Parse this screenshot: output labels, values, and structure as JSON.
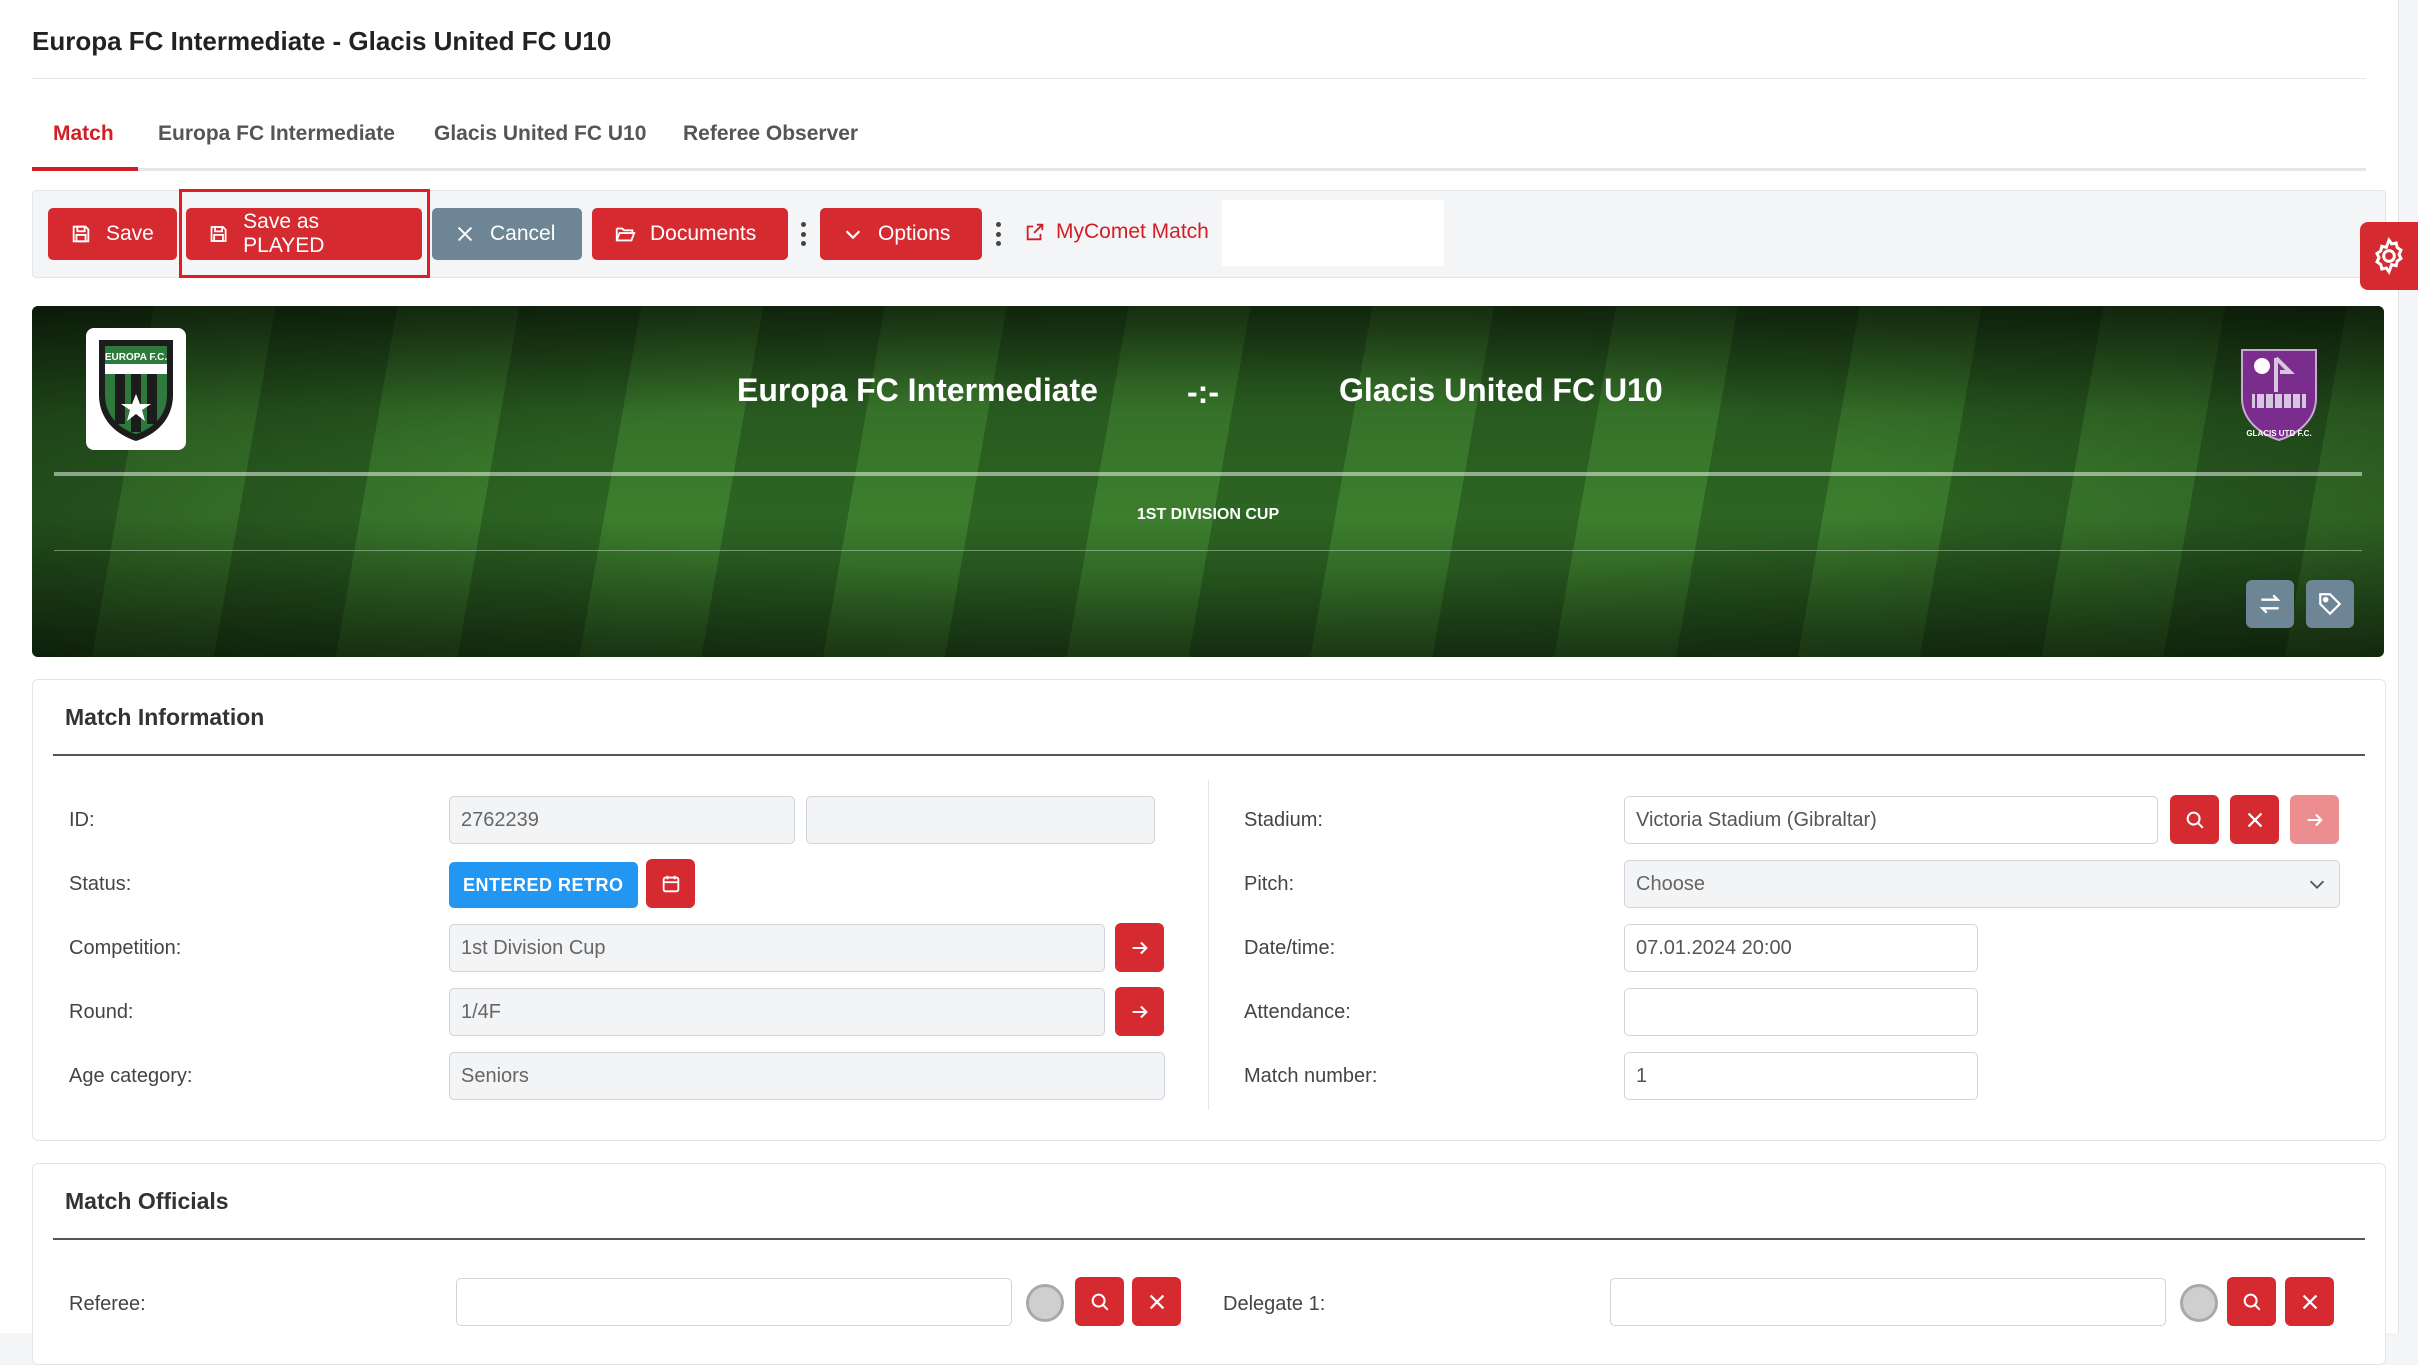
{
  "page_title": "Europa FC Intermediate - Glacis United FC U10",
  "tabs": [
    {
      "label": "Match",
      "active": true
    },
    {
      "label": "Europa FC Intermediate"
    },
    {
      "label": "Glacis United FC U10"
    },
    {
      "label": "Referee Observer"
    }
  ],
  "toolbar": {
    "save": "Save",
    "save_played": "Save as PLAYED",
    "cancel": "Cancel",
    "documents": "Documents",
    "options": "Options",
    "mycomet": "MyComet Match"
  },
  "banner": {
    "home_team": "Europa FC Intermediate",
    "score": "-:-",
    "away_team": "Glacis United FC U10",
    "competition": "1ST DIVISION CUP",
    "home_logo_text": "EUROPA F.C.",
    "away_logo_text": "GLACIS UTD F.C."
  },
  "match_info": {
    "title": "Match Information",
    "id_label": "ID:",
    "id_value": "2762239",
    "id_extra": "",
    "status_label": "Status:",
    "status_value": "ENTERED RETRO",
    "competition_label": "Competition:",
    "competition_value": "1st Division Cup",
    "round_label": "Round:",
    "round_value": "1/4F",
    "age_label": "Age category:",
    "age_value": "Seniors",
    "stadium_label": "Stadium:",
    "stadium_value": "Victoria Stadium (Gibraltar)",
    "pitch_label": "Pitch:",
    "pitch_value": "Choose",
    "datetime_label": "Date/time:",
    "datetime_value": "07.01.2024 20:00",
    "attendance_label": "Attendance:",
    "attendance_value": "",
    "match_number_label": "Match number:",
    "match_number_value": "1"
  },
  "officials": {
    "title": "Match Officials",
    "referee_label": "Referee:",
    "referee_value": "",
    "delegate_label": "Delegate 1:",
    "delegate_value": ""
  },
  "colors": {
    "accent": "#d52b30",
    "status_badge": "#2196f3",
    "secondary_button": "#6e8595"
  }
}
